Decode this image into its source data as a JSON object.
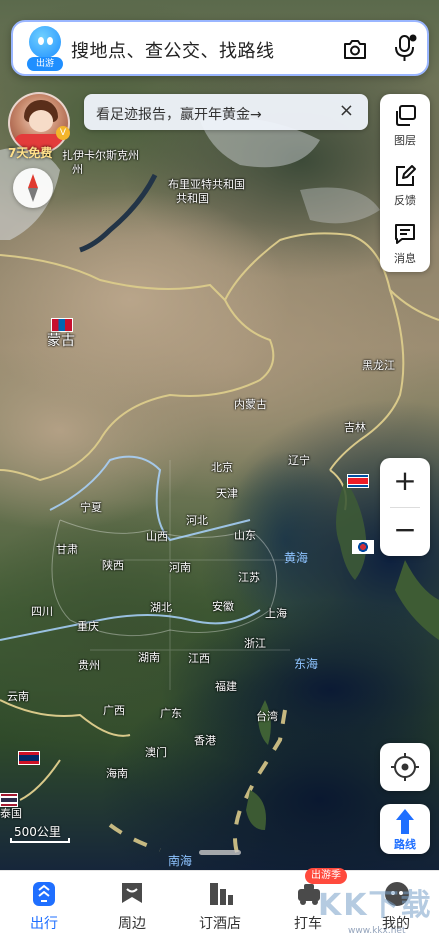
{
  "search": {
    "logo_tag": "出游",
    "placeholder": "搜地点、查公交、找路线"
  },
  "promo": {
    "avatar_label": "7天免费",
    "vip_badge": "V"
  },
  "banner": {
    "text": "看足迹报告，赢开年黄金→",
    "close": "×"
  },
  "tools": [
    {
      "label": "图层",
      "icon": "layers-icon"
    },
    {
      "label": "反馈",
      "icon": "feedback-edit-icon"
    },
    {
      "label": "消息",
      "icon": "message-icon"
    }
  ],
  "zoom": {
    "in": "+",
    "out": "−"
  },
  "route": {
    "label": "路线"
  },
  "scale": {
    "label": "500公里"
  },
  "map": {
    "places": [
      {
        "text": "布里亚特共和国",
        "line2": "共和国"
      },
      {
        "text": "扎伊卡尔斯克州",
        "line2": "州"
      },
      {
        "text": "蒙古"
      },
      {
        "text": "黑龙江"
      },
      {
        "text": "内蒙古"
      },
      {
        "text": "吉林"
      },
      {
        "text": "北京"
      },
      {
        "text": "辽宁"
      },
      {
        "text": "天津"
      },
      {
        "text": "宁夏"
      },
      {
        "text": "河北"
      },
      {
        "text": "山西"
      },
      {
        "text": "山东"
      },
      {
        "text": "甘肃"
      },
      {
        "text": "陕西"
      },
      {
        "text": "河南"
      },
      {
        "text": "江苏"
      },
      {
        "text": "四川"
      },
      {
        "text": "湖北"
      },
      {
        "text": "安徽"
      },
      {
        "text": "上海"
      },
      {
        "text": "重庆"
      },
      {
        "text": "浙江"
      },
      {
        "text": "贵州"
      },
      {
        "text": "湖南"
      },
      {
        "text": "江西"
      },
      {
        "text": "福建"
      },
      {
        "text": "云南"
      },
      {
        "text": "广西"
      },
      {
        "text": "广东"
      },
      {
        "text": "台湾"
      },
      {
        "text": "香港"
      },
      {
        "text": "澳门"
      },
      {
        "text": "海南"
      },
      {
        "text": "泰国"
      }
    ],
    "seas": [
      "黄海",
      "东海",
      "南海"
    ]
  },
  "tabs": [
    {
      "label": "出行",
      "icon": "travel-icon",
      "active": true
    },
    {
      "label": "周边",
      "icon": "nearby-icon"
    },
    {
      "label": "订酒店",
      "icon": "hotel-icon"
    },
    {
      "label": "打车",
      "icon": "taxi-icon",
      "badge": "出游季"
    },
    {
      "label": "我的",
      "icon": "profile-icon"
    }
  ],
  "watermark": {
    "text": "KK下载",
    "url": "www.kkx.net"
  },
  "colors": {
    "accent": "#1f6fff",
    "border_glow": "#9ab6ff",
    "badge_red": "#ff4a3d",
    "sea_label": "#8ec3ff",
    "boundary": "#d9c98a",
    "river": "#a9d3ff"
  }
}
